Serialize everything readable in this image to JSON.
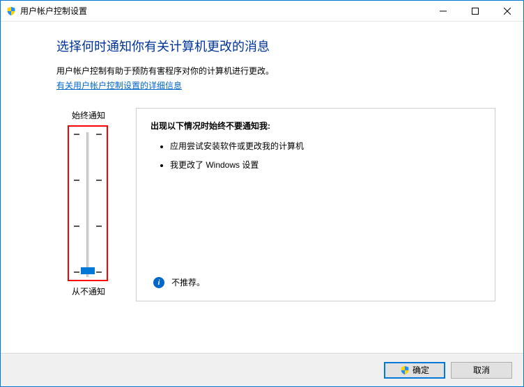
{
  "window": {
    "title": "用户帐户控制设置"
  },
  "content": {
    "heading": "选择何时通知你有关计算机更改的消息",
    "description": "用户帐户控制有助于预防有害程序对你的计算机进行更改。",
    "link": "有关用户帐户控制设置的详细信息"
  },
  "slider": {
    "topLabel": "始终通知",
    "bottomLabel": "从不通知"
  },
  "panel": {
    "title": "出现以下情况时始终不要通知我:",
    "items": [
      "应用尝试安装软件或更改我的计算机",
      "我更改了 Windows 设置"
    ],
    "recommendation": "不推荐。"
  },
  "footer": {
    "ok": "确定",
    "cancel": "取消"
  },
  "icons": {
    "info_glyph": "i"
  }
}
